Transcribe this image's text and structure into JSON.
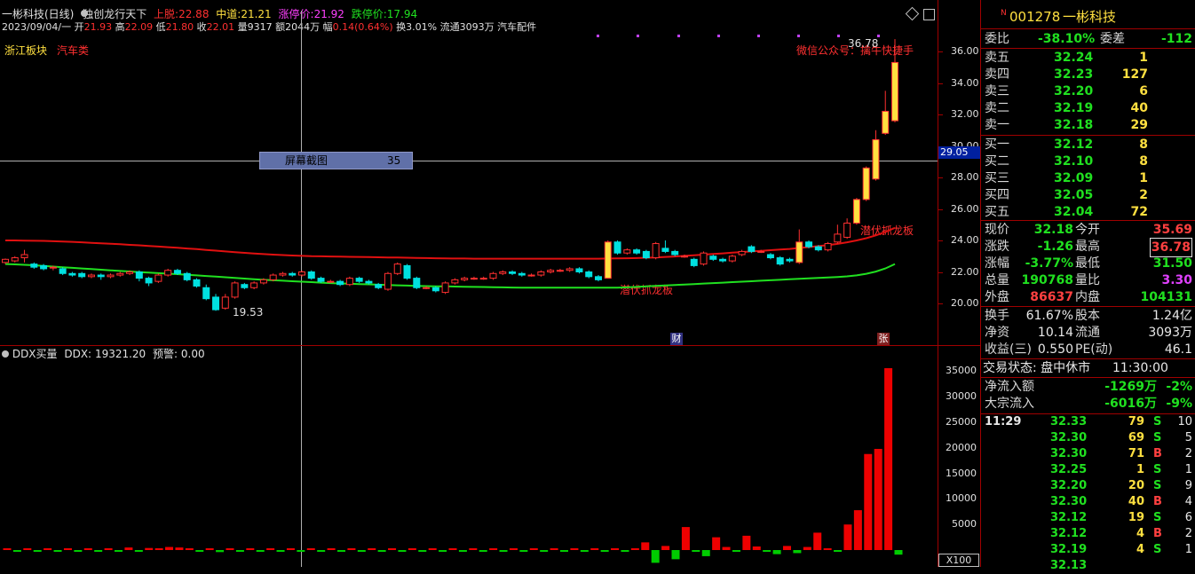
{
  "colors": {
    "up": "#ff3030",
    "down": "#00e0e0",
    "ma_red": "#e01010",
    "ma_green": "#20e020",
    "frame": "#a00000",
    "label_red": "#ff3030",
    "ddx_up": "#ee0000",
    "ddx_down": "#00cc00"
  },
  "header": {
    "title": "一彬科技(日线)",
    "indicator_name": "独创龙行天下",
    "upper_label": "上脱:",
    "upper_value": "22.88",
    "mid_label": "中道:",
    "mid_value": "21.21",
    "limit_up_label": "涨停价:",
    "limit_up_value": "21.92",
    "limit_down_label": "跌停价:",
    "limit_down_value": "17.94"
  },
  "info_line": {
    "date": "2023/09/04/一",
    "open_label": "开",
    "open": "21.93",
    "high_label": "高",
    "high": "22.09",
    "low_label": "低",
    "low": "21.80",
    "close_label": "收",
    "close": "22.01",
    "vol_label": "量",
    "vol": "9317",
    "amount_label": "额",
    "amount": "2044万",
    "change_label": "幅",
    "change": "0.14(0.64%)",
    "turnover_label": "换",
    "turnover": "3.01%",
    "float_label": "流通",
    "float": "3093万",
    "sector": "汽车配件"
  },
  "tags": {
    "sector1": "浙江板块",
    "sector2": "汽车类"
  },
  "annotations": {
    "wechat": "微信公众号：擒牛快捷手",
    "high_mark": "36.78",
    "low_mark": "19.53",
    "ambush1": "潜伏抓龙板",
    "ambush2": "潜伏抓龙板",
    "fin_badge": "财",
    "zhang_badge": "张"
  },
  "crosshair": {
    "tooltip_label": "屏幕截图",
    "tooltip_value": "35",
    "price_readout": "29.05"
  },
  "sub_chart": {
    "title": "DDX买量",
    "ddx_label": "DDX:",
    "ddx_value": "19321.20",
    "warn_label": "预警:",
    "warn_value": "0.00",
    "scale": "X100"
  },
  "price_axis": {
    "ticks": [
      "36.00",
      "34.00",
      "32.00",
      "30.00",
      "28.00",
      "26.00",
      "24.00",
      "22.00",
      "20.00"
    ]
  },
  "ddx_axis": {
    "ticks": [
      "35000",
      "30000",
      "25000",
      "20000",
      "15000",
      "10000",
      "5000"
    ]
  },
  "candles": [
    [
      22.6,
      22.8,
      22.5,
      22.85
    ],
    [
      22.7,
      22.9,
      22.6,
      23.0
    ],
    [
      22.9,
      23.1,
      22.6,
      23.4
    ],
    [
      22.5,
      22.3,
      22.2,
      22.6
    ],
    [
      22.4,
      22.2,
      22.1,
      22.5
    ],
    [
      22.3,
      22.3,
      22.1,
      22.4
    ],
    [
      22.2,
      21.9,
      21.8,
      22.3
    ],
    [
      21.9,
      21.8,
      21.7,
      22.0
    ],
    [
      21.9,
      21.7,
      21.6,
      22.0
    ],
    [
      21.7,
      21.8,
      21.6,
      21.9
    ],
    [
      21.8,
      21.7,
      21.5,
      21.9
    ],
    [
      21.7,
      21.8,
      21.6,
      21.9
    ],
    [
      21.8,
      21.9,
      21.7,
      22.0
    ],
    [
      21.9,
      22.0,
      21.8,
      22.1
    ],
    [
      22.0,
      21.6,
      21.4,
      22.1
    ],
    [
      21.6,
      21.3,
      21.1,
      21.7
    ],
    [
      21.4,
      21.8,
      21.3,
      21.9
    ],
    [
      21.8,
      22.1,
      21.7,
      22.2
    ],
    [
      22.1,
      21.9,
      21.8,
      22.2
    ],
    [
      21.9,
      21.5,
      21.4,
      22.0
    ],
    [
      21.5,
      21.1,
      21.0,
      21.6
    ],
    [
      21.0,
      20.3,
      20.2,
      21.2
    ],
    [
      20.4,
      19.6,
      19.53,
      20.6
    ],
    [
      19.7,
      20.4,
      19.6,
      20.6
    ],
    [
      20.4,
      21.3,
      20.3,
      21.4
    ],
    [
      21.2,
      21.0,
      20.9,
      21.3
    ],
    [
      21.0,
      21.3,
      20.9,
      21.4
    ],
    [
      21.3,
      21.5,
      21.2,
      21.6
    ],
    [
      21.5,
      21.8,
      21.4,
      21.9
    ],
    [
      21.8,
      21.9,
      21.7,
      22.0
    ],
    [
      21.9,
      21.8,
      21.7,
      22.0
    ],
    [
      21.8,
      22.0,
      21.7,
      22.1
    ],
    [
      22.0,
      21.6,
      21.5,
      22.1
    ],
    [
      21.6,
      21.4,
      21.3,
      21.7
    ],
    [
      21.4,
      21.4,
      21.3,
      21.5
    ],
    [
      21.4,
      21.2,
      21.1,
      21.5
    ],
    [
      21.2,
      21.6,
      21.1,
      21.7
    ],
    [
      21.6,
      21.4,
      21.3,
      21.7
    ],
    [
      21.4,
      21.3,
      21.2,
      21.5
    ],
    [
      21.2,
      21.0,
      20.9,
      21.3
    ],
    [
      20.9,
      21.9,
      20.8,
      22.0
    ],
    [
      21.9,
      22.5,
      21.8,
      22.6
    ],
    [
      22.4,
      21.6,
      21.5,
      22.5
    ],
    [
      21.6,
      21.0,
      20.9,
      21.7
    ],
    [
      21.0,
      21.0,
      20.9,
      21.1
    ],
    [
      21.0,
      20.8,
      20.7,
      21.1
    ],
    [
      20.7,
      21.3,
      20.6,
      21.4
    ],
    [
      21.3,
      21.5,
      21.2,
      21.6
    ],
    [
      21.5,
      21.6,
      21.4,
      21.7
    ],
    [
      21.6,
      21.6,
      21.5,
      21.7
    ],
    [
      21.6,
      21.6,
      21.5,
      21.7
    ],
    [
      21.6,
      21.9,
      21.5,
      22.0
    ],
    [
      21.9,
      22.0,
      21.8,
      22.1
    ],
    [
      22.0,
      21.9,
      21.8,
      22.1
    ],
    [
      21.9,
      21.8,
      21.7,
      22.0
    ],
    [
      21.8,
      21.8,
      21.7,
      21.9
    ],
    [
      21.8,
      22.0,
      21.7,
      22.1
    ],
    [
      22.0,
      22.1,
      21.9,
      22.2
    ],
    [
      22.1,
      22.1,
      22.0,
      22.2
    ],
    [
      22.1,
      22.2,
      22.0,
      22.3
    ],
    [
      22.2,
      22.0,
      21.9,
      22.3
    ],
    [
      22.0,
      21.7,
      21.6,
      22.1
    ],
    [
      21.7,
      21.5,
      21.4,
      21.8
    ],
    [
      21.6,
      23.9,
      21.6,
      24.0
    ],
    [
      23.9,
      23.2,
      23.1,
      24.0
    ],
    [
      23.2,
      23.4,
      23.1,
      23.5
    ],
    [
      23.4,
      23.2,
      23.1,
      23.5
    ],
    [
      23.3,
      22.9,
      22.8,
      23.4
    ],
    [
      22.9,
      23.8,
      22.8,
      23.9
    ],
    [
      23.5,
      23.3,
      23.2,
      24.0
    ],
    [
      23.3,
      23.1,
      23.0,
      23.4
    ],
    [
      23.0,
      23.0,
      22.9,
      23.1
    ],
    [
      22.8,
      22.4,
      22.3,
      22.9
    ],
    [
      22.5,
      23.2,
      22.4,
      23.3
    ],
    [
      23.0,
      22.8,
      22.7,
      23.1
    ],
    [
      22.8,
      22.7,
      22.6,
      22.9
    ],
    [
      22.7,
      23.0,
      22.6,
      23.1
    ],
    [
      23.1,
      23.3,
      23.0,
      23.4
    ],
    [
      23.6,
      23.3,
      23.2,
      23.7
    ],
    [
      23.3,
      23.3,
      23.2,
      23.4
    ],
    [
      23.1,
      22.9,
      22.8,
      23.2
    ],
    [
      22.9,
      22.5,
      22.4,
      23.0
    ],
    [
      22.8,
      22.7,
      22.6,
      22.9
    ],
    [
      22.6,
      23.9,
      22.5,
      24.7
    ],
    [
      23.9,
      23.6,
      23.5,
      24.0
    ],
    [
      23.6,
      23.4,
      23.3,
      23.7
    ],
    [
      23.4,
      23.8,
      23.3,
      23.9
    ],
    [
      23.9,
      24.4,
      23.8,
      25.0
    ],
    [
      24.2,
      25.1,
      24.1,
      25.4
    ],
    [
      25.1,
      26.6,
      25.0,
      26.7
    ],
    [
      26.6,
      28.6,
      26.5,
      28.7
    ],
    [
      27.9,
      30.4,
      27.8,
      31.0
    ],
    [
      30.8,
      32.2,
      30.7,
      33.5
    ],
    [
      31.6,
      35.3,
      31.5,
      36.78
    ]
  ],
  "ma_red": [
    24.0,
    24.0,
    23.99,
    23.98,
    23.97,
    23.95,
    23.93,
    23.91,
    23.88,
    23.85,
    23.82,
    23.79,
    23.76,
    23.72,
    23.69,
    23.65,
    23.61,
    23.57,
    23.53,
    23.49,
    23.45,
    23.4,
    23.35,
    23.3,
    23.25,
    23.21,
    23.17,
    23.13,
    23.1,
    23.07,
    23.04,
    23.02,
    23.0,
    22.99,
    22.98,
    22.97,
    22.96,
    22.95,
    22.94,
    22.93,
    22.92,
    22.91,
    22.9,
    22.89,
    22.88,
    22.87,
    22.86,
    22.85,
    22.85,
    22.84,
    22.84,
    22.84,
    22.84,
    22.84,
    22.84,
    22.84,
    22.84,
    22.84,
    22.84,
    22.84,
    22.84,
    22.84,
    22.84,
    22.85,
    22.86,
    22.87,
    22.88,
    22.9,
    22.92,
    22.95,
    22.98,
    23.02,
    23.06,
    23.1,
    23.14,
    23.18,
    23.22,
    23.26,
    23.3,
    23.34,
    23.38,
    23.42,
    23.46,
    23.52,
    23.58,
    23.64,
    23.7,
    23.78,
    23.88,
    24.0,
    24.14,
    24.32,
    24.54,
    24.8
  ],
  "ma_green": [
    22.5,
    22.48,
    22.45,
    22.42,
    22.38,
    22.34,
    22.3,
    22.26,
    22.22,
    22.18,
    22.14,
    22.1,
    22.06,
    22.03,
    21.99,
    21.96,
    21.92,
    21.89,
    21.86,
    21.82,
    21.78,
    21.74,
    21.7,
    21.66,
    21.62,
    21.58,
    21.54,
    21.5,
    21.47,
    21.44,
    21.41,
    21.38,
    21.35,
    21.32,
    21.29,
    21.27,
    21.25,
    21.23,
    21.21,
    21.19,
    21.17,
    21.15,
    21.13,
    21.11,
    21.1,
    21.09,
    21.08,
    21.07,
    21.06,
    21.05,
    21.04,
    21.03,
    21.02,
    21.01,
    21.0,
    21.0,
    21.0,
    21.0,
    21.0,
    21.0,
    21.0,
    21.0,
    21.0,
    21.0,
    21.0,
    21.02,
    21.05,
    21.08,
    21.11,
    21.14,
    21.17,
    21.2,
    21.23,
    21.26,
    21.29,
    21.32,
    21.35,
    21.38,
    21.41,
    21.44,
    21.47,
    21.5,
    21.53,
    21.56,
    21.59,
    21.62,
    21.65,
    21.68,
    21.72,
    21.78,
    21.88,
    22.02,
    22.22,
    22.5
  ],
  "ddx": [
    300,
    -300,
    200,
    -200,
    300,
    -200,
    200,
    -300,
    300,
    -200,
    250,
    -250,
    500,
    -300,
    400,
    300,
    600,
    500,
    300,
    -200,
    300,
    -400,
    200,
    -300,
    300,
    -200,
    300,
    -200,
    300,
    -300,
    300,
    -200,
    300,
    -200,
    200,
    -200,
    300,
    -300,
    300,
    -200,
    250,
    -250,
    300,
    -200,
    300,
    -300,
    300,
    -200,
    250,
    -250,
    300,
    -200,
    300,
    -300,
    300,
    -200,
    250,
    -250,
    300,
    -200,
    300,
    -300,
    300,
    1500,
    -2500,
    800,
    -1800,
    4500,
    -300,
    -1200,
    2500,
    600,
    -200,
    2800,
    700,
    -300,
    -800,
    800,
    -600,
    600,
    3400,
    300,
    -200,
    5000,
    7800,
    18800,
    19800,
    35600,
    -900
  ],
  "quote": {
    "code_tag": "N",
    "code": "001278",
    "name": "一彬科技",
    "webi_label": "委比",
    "webi": "-38.10%",
    "wecha_label": "委差",
    "wecha": "-112",
    "asks": [
      {
        "label": "卖五",
        "price": "32.24",
        "vol": "1"
      },
      {
        "label": "卖四",
        "price": "32.23",
        "vol": "127"
      },
      {
        "label": "卖三",
        "price": "32.20",
        "vol": "6"
      },
      {
        "label": "卖二",
        "price": "32.19",
        "vol": "40"
      },
      {
        "label": "卖一",
        "price": "32.18",
        "vol": "29"
      }
    ],
    "bids": [
      {
        "label": "买一",
        "price": "32.12",
        "vol": "8"
      },
      {
        "label": "买二",
        "price": "32.10",
        "vol": "8"
      },
      {
        "label": "买三",
        "price": "32.09",
        "vol": "1"
      },
      {
        "label": "买四",
        "price": "32.05",
        "vol": "2"
      },
      {
        "label": "买五",
        "price": "32.04",
        "vol": "72"
      }
    ],
    "stats": [
      {
        "l1": "现价",
        "v1": "32.18",
        "l2": "今开",
        "v2": "35.69"
      },
      {
        "l1": "涨跌",
        "v1": "-1.26",
        "l2": "最高",
        "v2": "36.78"
      },
      {
        "l1": "涨幅",
        "v1": "-3.77%",
        "l2": "最低",
        "v2": "31.50"
      },
      {
        "l1": "总量",
        "v1": "190768",
        "l2": "量比",
        "v2": "3.30"
      },
      {
        "l1": "外盘",
        "v1": "86637",
        "l2": "内盘",
        "v2": "104131"
      }
    ],
    "fund": [
      {
        "l1": "换手",
        "v1": "61.67%",
        "l2": "股本",
        "v2": "1.24亿"
      },
      {
        "l1": "净资",
        "v1": "10.14",
        "l2": "流通",
        "v2": "3093万"
      },
      {
        "l1": "收益(三)",
        "v1": "0.550",
        "l2": "PE(动)",
        "v2": "46.1"
      }
    ],
    "trade_status": "交易状态: 盘中休市",
    "trade_time": "11:30:00",
    "netflow_label": "净流入额",
    "netflow": "-1269万",
    "netflow_pct": "-2%",
    "block_label": "大宗流入",
    "block": "-6016万",
    "block_pct": "-9%"
  },
  "ticks": [
    {
      "time": "11:29",
      "price": "32.33",
      "vol": "79",
      "side": "S",
      "n": "10"
    },
    {
      "time": "",
      "price": "32.30",
      "vol": "69",
      "side": "S",
      "n": "5"
    },
    {
      "time": "",
      "price": "32.30",
      "vol": "71",
      "side": "B",
      "n": "2"
    },
    {
      "time": "",
      "price": "32.25",
      "vol": "1",
      "side": "S",
      "n": "1"
    },
    {
      "time": "",
      "price": "32.20",
      "vol": "20",
      "side": "S",
      "n": "9"
    },
    {
      "time": "",
      "price": "32.30",
      "vol": "40",
      "side": "B",
      "n": "4"
    },
    {
      "time": "",
      "price": "32.12",
      "vol": "19",
      "side": "S",
      "n": "6"
    },
    {
      "time": "",
      "price": "32.12",
      "vol": "4",
      "side": "B",
      "n": "2"
    },
    {
      "time": "",
      "price": "32.19",
      "vol": "4",
      "side": "S",
      "n": "1"
    },
    {
      "time": "",
      "price": "32.13",
      "vol": "",
      "side": "",
      "n": ""
    }
  ]
}
